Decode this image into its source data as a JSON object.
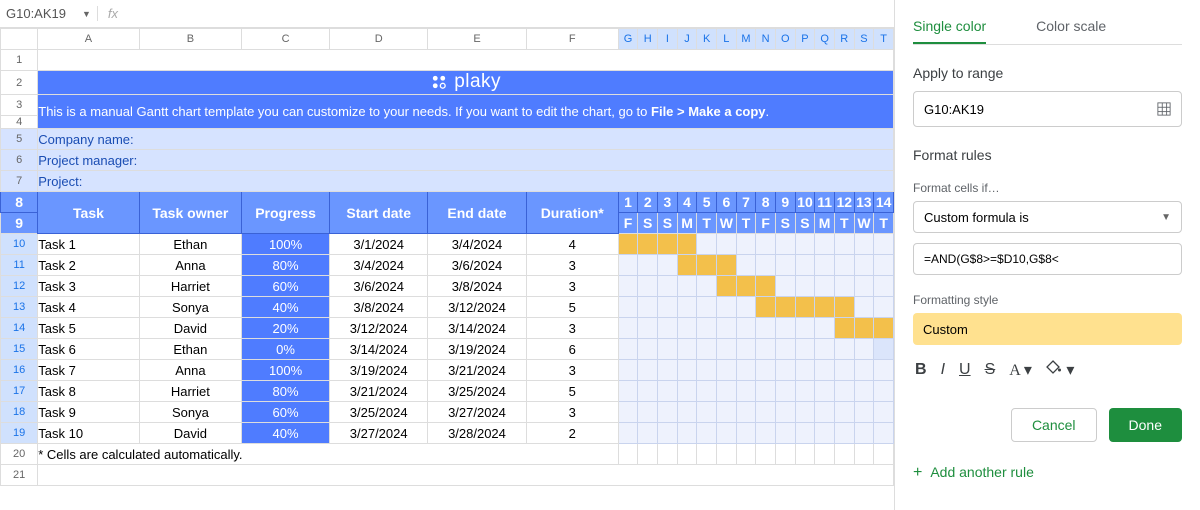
{
  "namebox": "G10:AK19",
  "fx": "fx",
  "cols": [
    "A",
    "B",
    "C",
    "D",
    "E",
    "F"
  ],
  "narrow_cols": [
    "G",
    "H",
    "I",
    "J",
    "K",
    "L",
    "M",
    "N",
    "O",
    "P",
    "Q",
    "R",
    "S",
    "T"
  ],
  "rows": [
    "1",
    "2",
    "3",
    "4",
    "5",
    "6",
    "7",
    "8",
    "9",
    "10",
    "11",
    "12",
    "13",
    "14",
    "15",
    "16",
    "17",
    "18",
    "19",
    "20",
    "21"
  ],
  "logo_text": "plaky",
  "instruction_pre": "This is a manual Gantt chart template you can customize to your needs. If you want to edit the chart, go to ",
  "instruction_bold": "File > Make a copy",
  "instruction_post": ".",
  "meta": {
    "company": "Company name:",
    "pm": "Project manager:",
    "project": "Project:"
  },
  "headers": {
    "task": "Task",
    "owner": "Task owner",
    "progress": "Progress",
    "start": "Start date",
    "end": "End date",
    "duration": "Duration*"
  },
  "day_nums": [
    "1",
    "2",
    "3",
    "4",
    "5",
    "6",
    "7",
    "8",
    "9",
    "10",
    "11",
    "12",
    "13",
    "14"
  ],
  "day_letters": [
    "F",
    "S",
    "S",
    "M",
    "T",
    "W",
    "T",
    "F",
    "S",
    "S",
    "M",
    "T",
    "W",
    "T"
  ],
  "tasks": [
    {
      "task": "Task 1",
      "owner": "Ethan",
      "progress": "100%",
      "start": "3/1/2024",
      "end": "3/4/2024",
      "dur": "4",
      "bar": [
        1,
        1,
        1,
        1,
        0,
        0,
        0,
        0,
        0,
        0,
        0,
        0,
        0,
        0
      ]
    },
    {
      "task": "Task 2",
      "owner": "Anna",
      "progress": "80%",
      "start": "3/4/2024",
      "end": "3/6/2024",
      "dur": "3",
      "bar": [
        0,
        0,
        0,
        1,
        1,
        1,
        0,
        0,
        0,
        0,
        0,
        0,
        0,
        0
      ]
    },
    {
      "task": "Task 3",
      "owner": "Harriet",
      "progress": "60%",
      "start": "3/6/2024",
      "end": "3/8/2024",
      "dur": "3",
      "bar": [
        0,
        0,
        0,
        0,
        0,
        1,
        1,
        1,
        0,
        0,
        0,
        0,
        0,
        0
      ]
    },
    {
      "task": "Task 4",
      "owner": "Sonya",
      "progress": "40%",
      "start": "3/8/2024",
      "end": "3/12/2024",
      "dur": "5",
      "bar": [
        0,
        0,
        0,
        0,
        0,
        0,
        0,
        1,
        1,
        1,
        1,
        1,
        0,
        0
      ]
    },
    {
      "task": "Task 5",
      "owner": "David",
      "progress": "20%",
      "start": "3/12/2024",
      "end": "3/14/2024",
      "dur": "3",
      "bar": [
        0,
        0,
        0,
        0,
        0,
        0,
        0,
        0,
        0,
        0,
        0,
        1,
        1,
        1
      ]
    },
    {
      "task": "Task 6",
      "owner": "Ethan",
      "progress": "0%",
      "start": "3/14/2024",
      "end": "3/19/2024",
      "dur": "6",
      "bar": [
        0,
        0,
        0,
        0,
        0,
        0,
        0,
        0,
        0,
        0,
        0,
        0,
        0,
        2
      ]
    },
    {
      "task": "Task 7",
      "owner": "Anna",
      "progress": "100%",
      "start": "3/19/2024",
      "end": "3/21/2024",
      "dur": "3",
      "bar": [
        0,
        0,
        0,
        0,
        0,
        0,
        0,
        0,
        0,
        0,
        0,
        0,
        0,
        0
      ]
    },
    {
      "task": "Task 8",
      "owner": "Harriet",
      "progress": "80%",
      "start": "3/21/2024",
      "end": "3/25/2024",
      "dur": "5",
      "bar": [
        0,
        0,
        0,
        0,
        0,
        0,
        0,
        0,
        0,
        0,
        0,
        0,
        0,
        0
      ]
    },
    {
      "task": "Task 9",
      "owner": "Sonya",
      "progress": "60%",
      "start": "3/25/2024",
      "end": "3/27/2024",
      "dur": "3",
      "bar": [
        0,
        0,
        0,
        0,
        0,
        0,
        0,
        0,
        0,
        0,
        0,
        0,
        0,
        0
      ]
    },
    {
      "task": "Task 10",
      "owner": "David",
      "progress": "40%",
      "start": "3/27/2024",
      "end": "3/28/2024",
      "dur": "2",
      "bar": [
        0,
        0,
        0,
        0,
        0,
        0,
        0,
        0,
        0,
        0,
        0,
        0,
        0,
        0
      ]
    }
  ],
  "footnote": "* Cells are calculated automatically.",
  "sidebar": {
    "tab1": "Single color",
    "tab2": "Color scale",
    "apply_to_range": "Apply to range",
    "range_value": "G10:AK19",
    "format_rules": "Format rules",
    "format_if": "Format cells if…",
    "rule_select": "Custom formula is",
    "formula_value": "=AND(G$8>=$D10,G$8<",
    "formatting_style": "Formatting style",
    "style_name": "Custom",
    "cancel": "Cancel",
    "done": "Done",
    "add_rule": "Add another rule"
  }
}
